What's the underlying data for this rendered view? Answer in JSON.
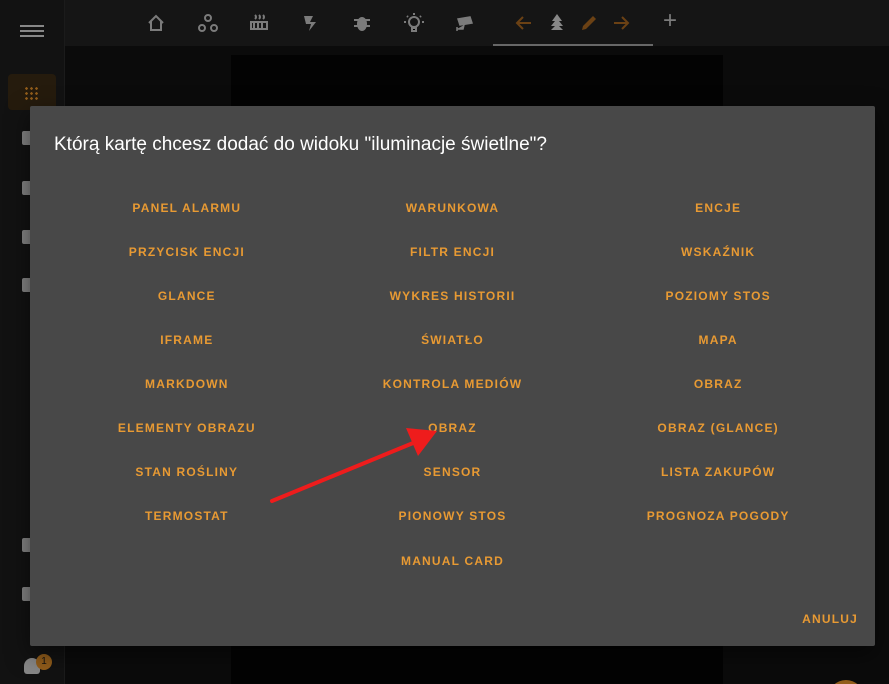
{
  "app": {
    "menu_icon": "hamburger-icon",
    "notification_count": "1",
    "view_tabs": [
      {
        "icon": "home-icon"
      },
      {
        "icon": "network-icon"
      },
      {
        "icon": "radiator-icon"
      },
      {
        "icon": "weather-lightning-icon"
      },
      {
        "icon": "bug-icon"
      },
      {
        "icon": "lightbulb-icon"
      },
      {
        "icon": "cctv-icon"
      }
    ],
    "active_tab": {
      "icon": "pine-tree-icon",
      "edit_controls": [
        "arrow-left-icon",
        "pencil-icon",
        "arrow-right-icon"
      ]
    },
    "add_view_icon": "plus-icon",
    "accent_color": "#e89a33"
  },
  "dialog": {
    "title": "Którą kartę chcesz dodać do widoku \"iluminacje świetlne\"?",
    "cards": [
      "PANEL ALARMU",
      "WARUNKOWA",
      "ENCJE",
      "PRZYCISK ENCJI",
      "FILTR ENCJI",
      "WSKAŹNIK",
      "GLANCE",
      "WYKRES HISTORII",
      "POZIOMY STOS",
      "IFRAME",
      "ŚWIATŁO",
      "MAPA",
      "MARKDOWN",
      "KONTROLA MEDIÓW",
      "OBRAZ",
      "ELEMENTY OBRAZU",
      "OBRAZ",
      "OBRAZ (GLANCE)",
      "STAN ROŚLINY",
      "SENSOR",
      "LISTA ZAKUPÓW",
      "TERMOSTAT",
      "PIONOWY STOS",
      "PROGNOZA POGODY"
    ],
    "manual_card": "MANUAL CARD",
    "cancel": "ANULUJ"
  }
}
